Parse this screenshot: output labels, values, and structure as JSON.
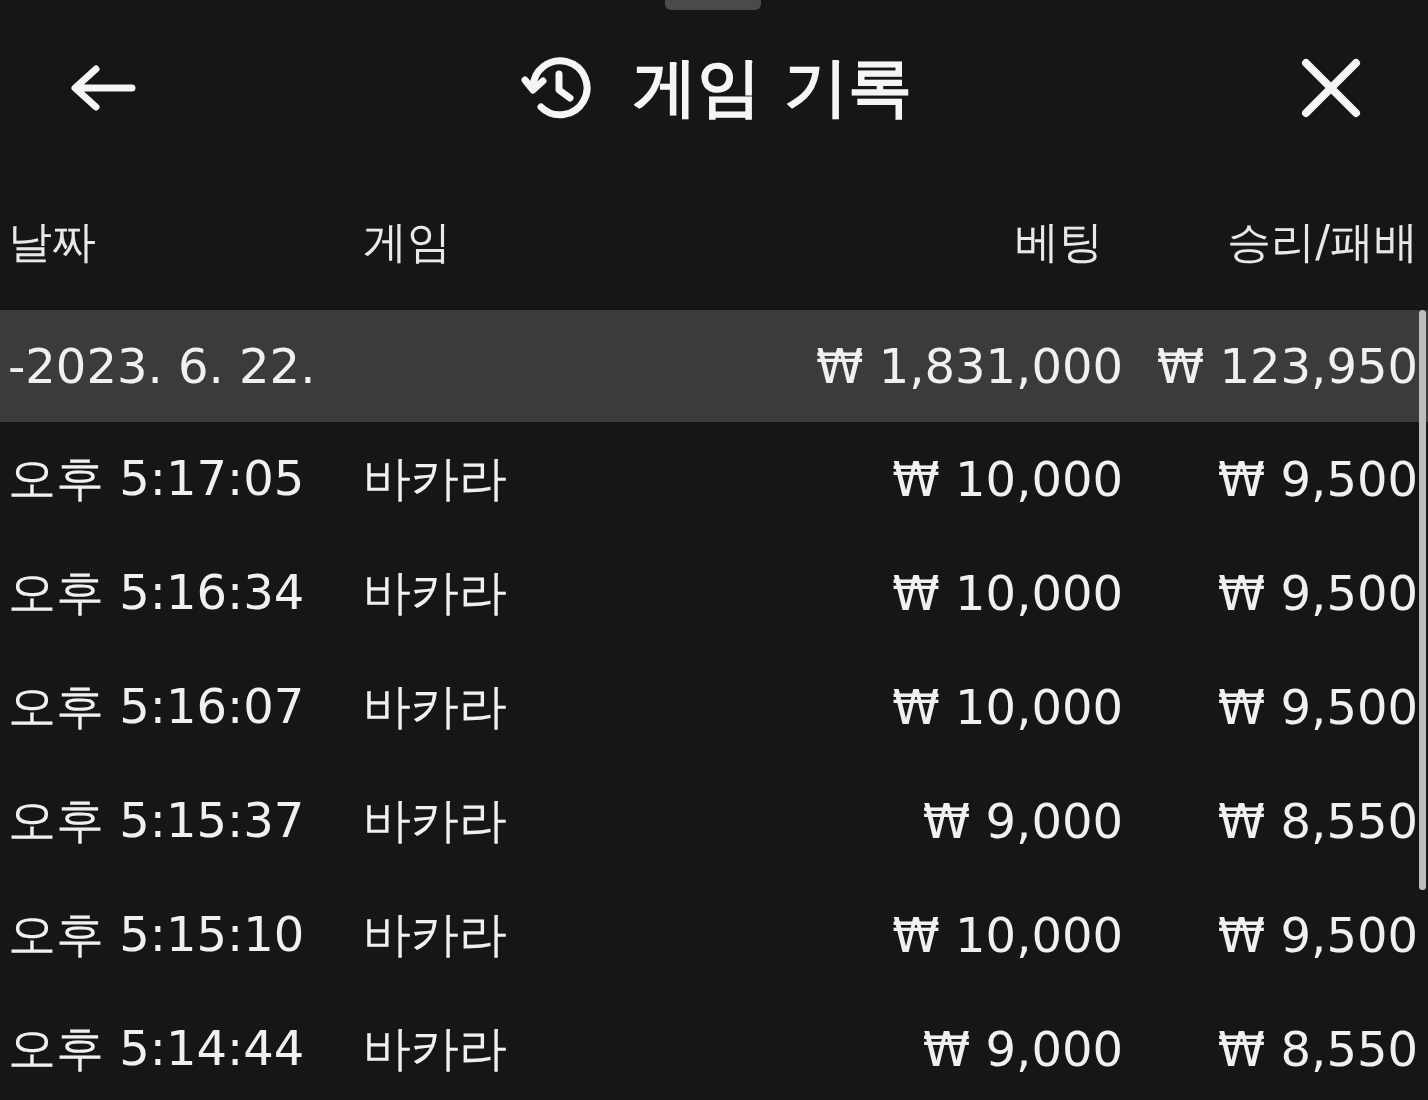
{
  "header": {
    "title": "게임 기록"
  },
  "table": {
    "columns": [
      "날짜",
      "게임",
      "베팅",
      "승리/패배"
    ],
    "groups": [
      {
        "date": "-2023. 6. 22.",
        "bet": "₩ 1,831,000",
        "result": "₩ 123,950",
        "rows": [
          {
            "time": "오후 5:17:05",
            "game": "바카라",
            "bet": "₩ 10,000",
            "result": "₩ 9,500"
          },
          {
            "time": "오후 5:16:34",
            "game": "바카라",
            "bet": "₩ 10,000",
            "result": "₩ 9,500"
          },
          {
            "time": "오후 5:16:07",
            "game": "바카라",
            "bet": "₩ 10,000",
            "result": "₩ 9,500"
          },
          {
            "time": "오후 5:15:37",
            "game": "바카라",
            "bet": "₩ 9,000",
            "result": "₩ 8,550"
          },
          {
            "time": "오후 5:15:10",
            "game": "바카라",
            "bet": "₩ 10,000",
            "result": "₩ 9,500"
          },
          {
            "time": "오후 5:14:44",
            "game": "바카라",
            "bet": "₩ 9,000",
            "result": "₩ 8,550"
          }
        ]
      }
    ]
  }
}
